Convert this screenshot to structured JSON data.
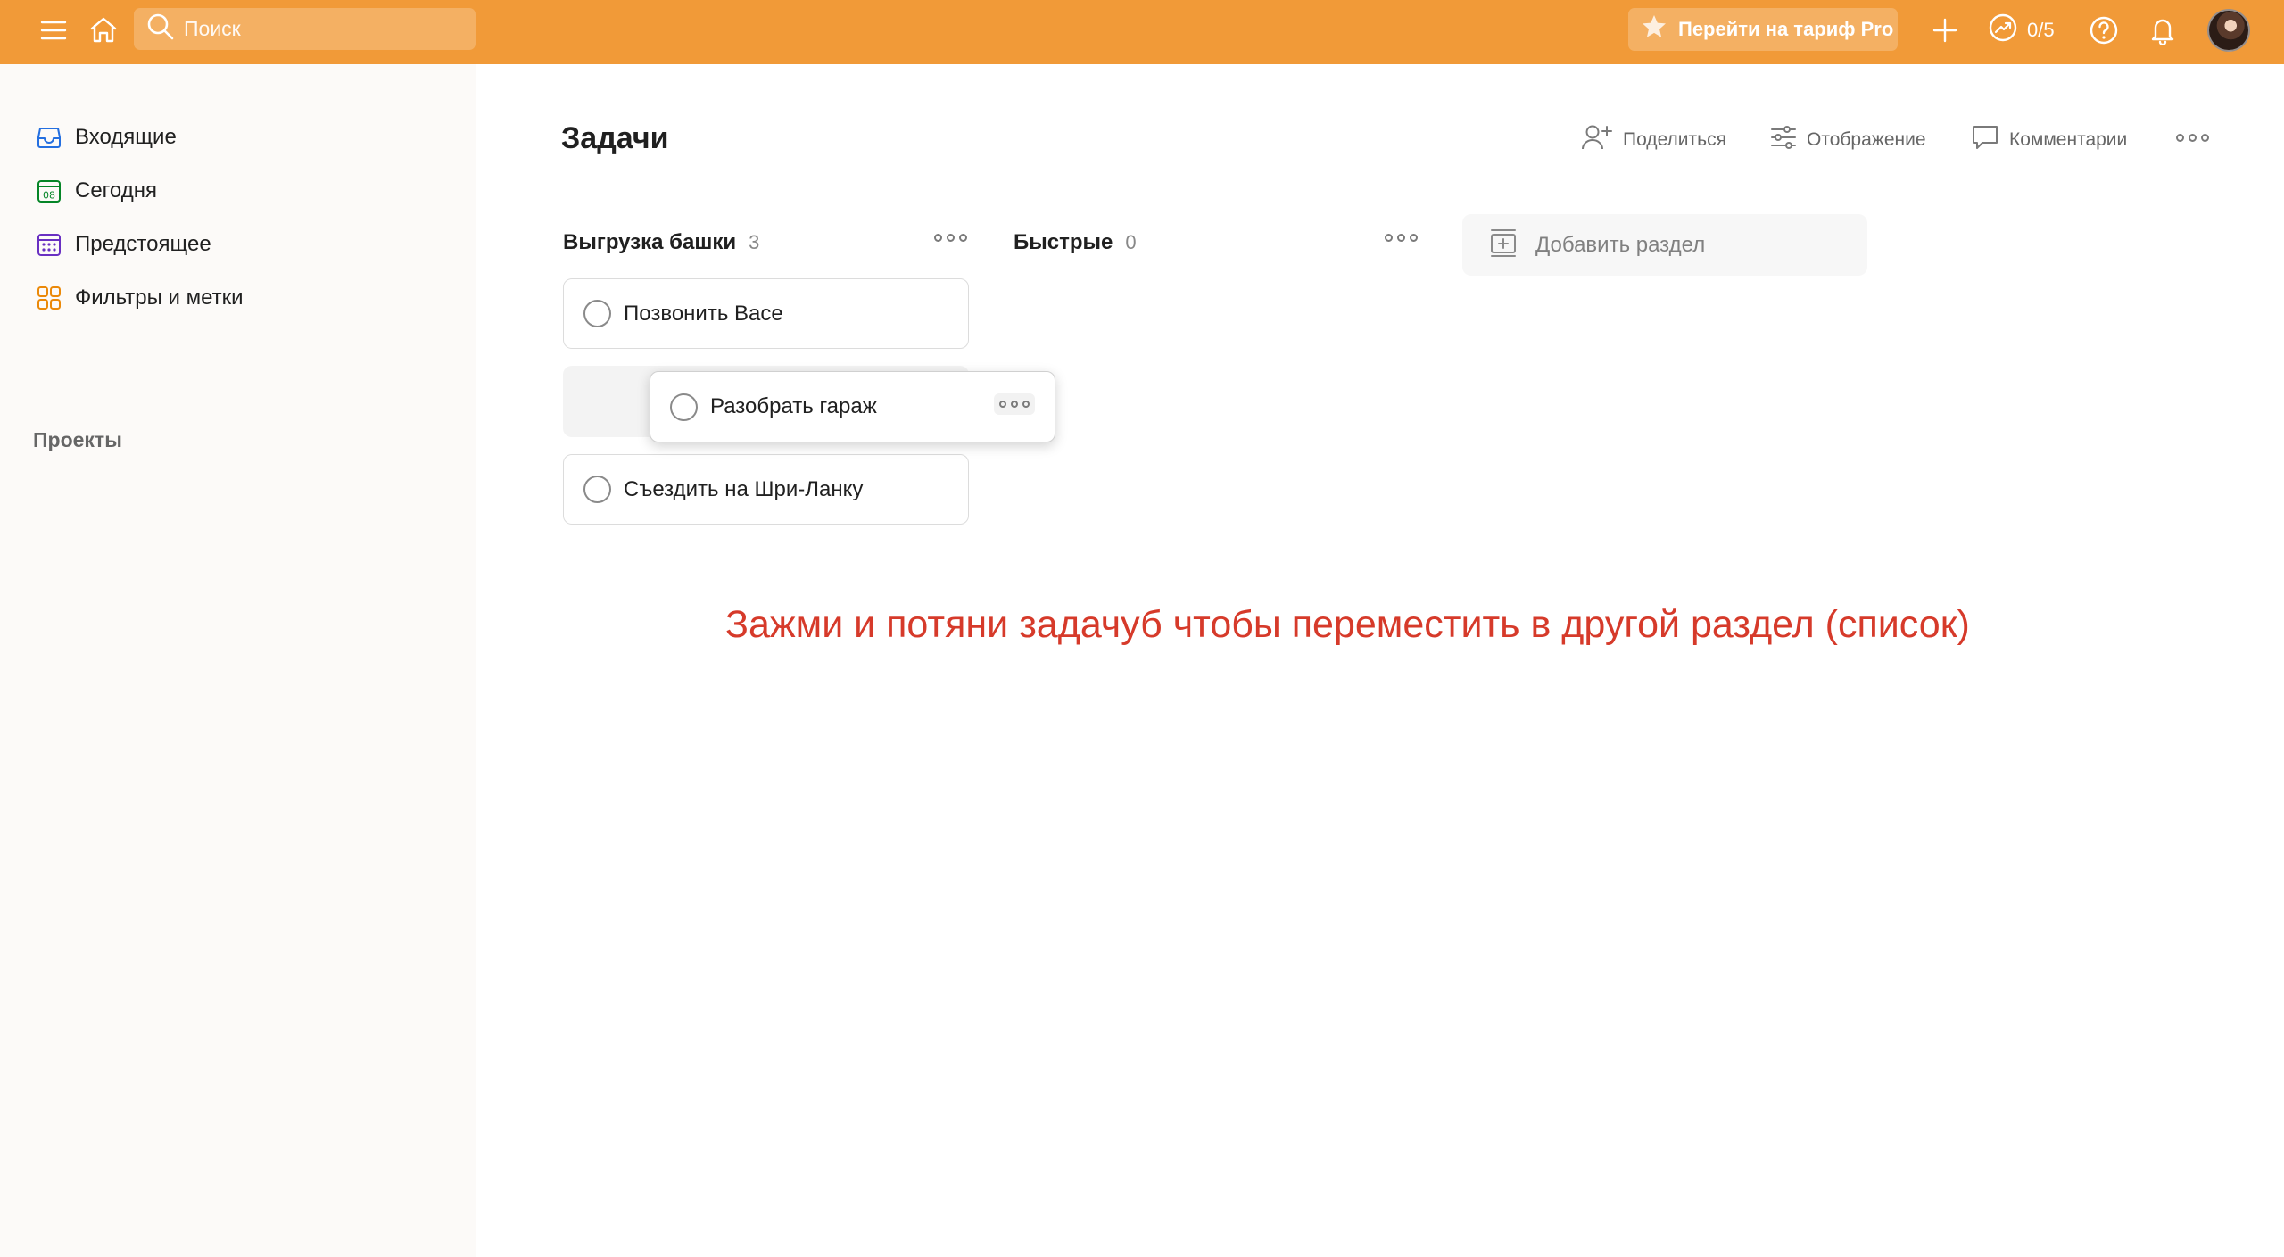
{
  "topbar": {
    "search_placeholder": "Поиск",
    "pro_label": "Перейти на тариф Pro",
    "karma": "0/5",
    "bg_color": "#f19a38",
    "icons": [
      "menu-icon",
      "home-icon",
      "search-icon",
      "star-icon",
      "plus-icon",
      "karma-trend-icon",
      "help-icon",
      "bell-icon"
    ]
  },
  "sidebar": {
    "items": [
      {
        "label": "Входящие",
        "icon": "inbox-icon",
        "color": "#246fe0"
      },
      {
        "label": "Сегодня",
        "icon": "calendar-today-icon",
        "color": "#058527",
        "day": "08"
      },
      {
        "label": "Предстоящее",
        "icon": "calendar-upcoming-icon",
        "color": "#692fc2"
      },
      {
        "label": "Фильтры и метки",
        "icon": "filters-labels-icon",
        "color": "#eb8909"
      }
    ],
    "projects_title": "Проекты"
  },
  "main": {
    "title": "Задачи",
    "actions": {
      "share": "Поделиться",
      "view": "Отображение",
      "comments": "Комментарии"
    },
    "sections": [
      {
        "title": "Выгрузка башки",
        "count": "3",
        "tasks": [
          "Позвонить Васе",
          "Разобрать гараж",
          "Съездить на Шри-Ланку"
        ]
      },
      {
        "title": "Быстрые",
        "count": "0",
        "tasks": []
      }
    ],
    "dragging_task": "Разобрать гараж",
    "add_section": "Добавить раздел"
  },
  "annotation": {
    "text": "Зажми и потяни задачуб чтобы переместить в другой раздел (список)",
    "color": "#d63a2a"
  }
}
